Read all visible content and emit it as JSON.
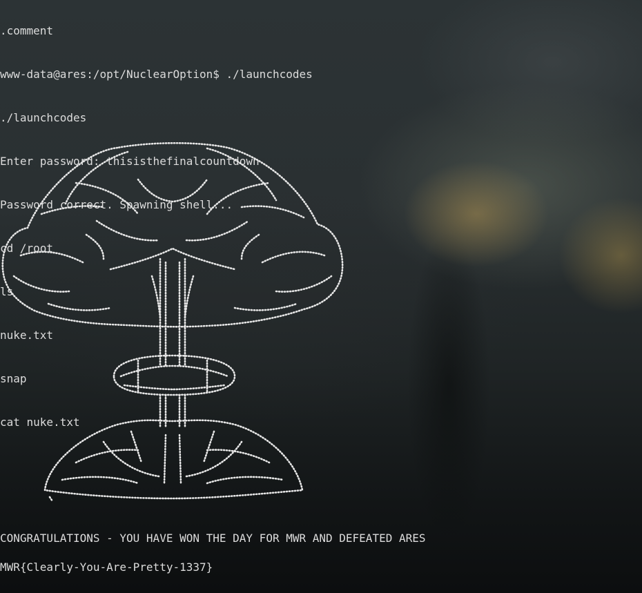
{
  "terminal": {
    "lines": [
      ".comment",
      "www-data@ares:/opt/NuclearOption$ ./launchcodes",
      "./launchcodes",
      "Enter password: thisisthefinalcountdown",
      "Password correct. Spawning shell...",
      "cd /root",
      "ls",
      "nuke.txt",
      "snap",
      "cat nuke.txt"
    ],
    "art_name": "mushroom-cloud-ascii-art",
    "congrats": "CONGRATULATIONS - YOU HAVE WON THE DAY FOR MWR AND DEFEATED ARES",
    "flag": "MWR{Clearly-You-Are-Pretty-1337}"
  },
  "colors": {
    "text": "#dcdcdc",
    "background": "#1f2426",
    "glow": "#a88c4e"
  }
}
